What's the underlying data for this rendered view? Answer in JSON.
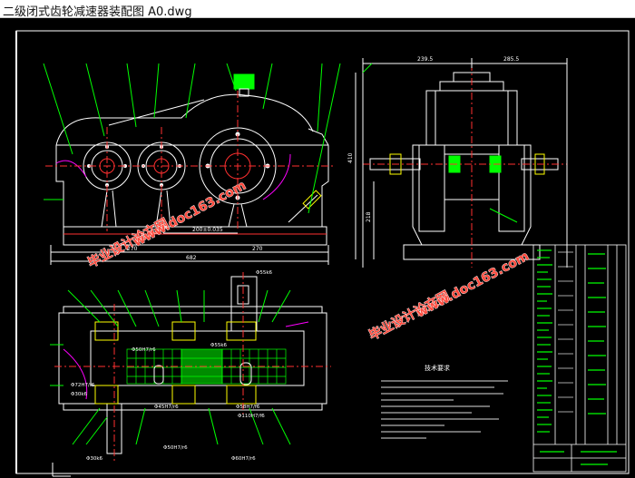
{
  "window": {
    "title": "二级闭式齿轮减速器装配图 A0.dwg"
  },
  "drawing": {
    "dims_front": {
      "d1": "270",
      "d2": "682",
      "d3": "270",
      "center": "200±0.035"
    },
    "dims_side": {
      "top_left": "239.5",
      "top_right": "285.5",
      "height": "410",
      "height2": "218"
    },
    "dims_plan": {
      "shaft_top": "Φ55k6",
      "d_left1": "Φ72H7/f6",
      "d_left2": "Φ30k6",
      "d_mid1": "Φ50H7/r6",
      "d_mid2": "Φ45H7/r6",
      "d_mid3": "Φ55k6",
      "d_right1": "Φ58H7/f6",
      "d_right2": "Φ110H7/f6",
      "d_bot1": "Φ30k6",
      "d_bot2": "Φ50H7/r6",
      "d_bot3": "Φ60H7/r6"
    },
    "notes_title": "技术要求"
  },
  "watermarks": {
    "text1": "毕业设计论文网",
    "text2": "www.doc163.com"
  },
  "colors": {
    "line_white": "#ffffff",
    "line_green": "#00ff00",
    "line_magenta": "#ff00ff",
    "line_red": "#ff3030",
    "line_yellow": "#ffff00",
    "watermark": "#ff4a3d"
  }
}
